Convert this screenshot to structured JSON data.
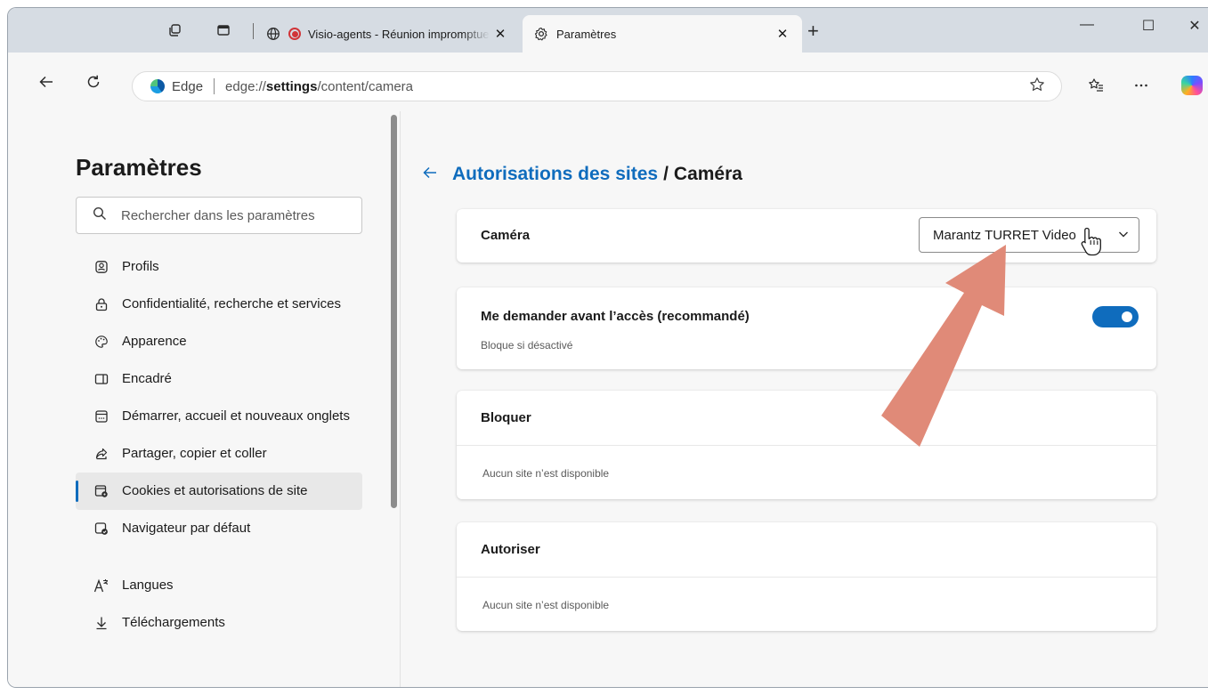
{
  "browser": {
    "tabs": [
      {
        "title": "Visio-agents - Réunion impromptue",
        "close": "✕",
        "favicon": "globe-icon",
        "recording": true
      },
      {
        "title": "Paramètres",
        "close": "✕",
        "favicon": "gear-icon"
      }
    ],
    "new_tab": "+",
    "window_controls": {
      "minimize": "—",
      "maximize": "☐",
      "close": "✕"
    },
    "address": {
      "label": "Edge",
      "url_prefix": "edge://",
      "url_bold": "settings",
      "url_rest": "/content/camera"
    }
  },
  "sidebar": {
    "title": "Paramètres",
    "search_placeholder": "Rechercher dans les paramètres",
    "items": [
      {
        "label": "Profils",
        "icon": "profile-icon"
      },
      {
        "label": "Confidentialité, recherche et services",
        "icon": "lock-icon"
      },
      {
        "label": "Apparence",
        "icon": "palette-icon"
      },
      {
        "label": "Encadré",
        "icon": "sidebar-panel-icon"
      },
      {
        "label": "Démarrer, accueil et nouveaux onglets",
        "icon": "home-icon"
      },
      {
        "label": "Partager, copier et coller",
        "icon": "share-icon"
      },
      {
        "label": "Cookies et autorisations de site",
        "icon": "cookie-settings-icon",
        "selected": true
      },
      {
        "label": "Navigateur par défaut",
        "icon": "default-browser-icon"
      },
      {
        "label": "Langues",
        "icon": "language-icon"
      },
      {
        "label": "Téléchargements",
        "icon": "download-icon"
      }
    ]
  },
  "main": {
    "breadcrumb_link": "Autorisations des sites",
    "breadcrumb_sep": "/",
    "breadcrumb_current": "Caméra",
    "camera": {
      "label": "Caméra",
      "selected_device": "Marantz TURRET Video"
    },
    "ask": {
      "label": "Me demander avant l’accès (recommandé)",
      "sub": "Bloque si désactivé",
      "enabled": true
    },
    "block": {
      "label": "Bloquer",
      "empty": "Aucun site n’est disponible"
    },
    "allow": {
      "label": "Autoriser",
      "empty": "Aucun site n’est disponible"
    }
  },
  "colors": {
    "accent": "#0f6cbd",
    "annotation_arrow": "#e08a78",
    "recording": "#d13438"
  }
}
